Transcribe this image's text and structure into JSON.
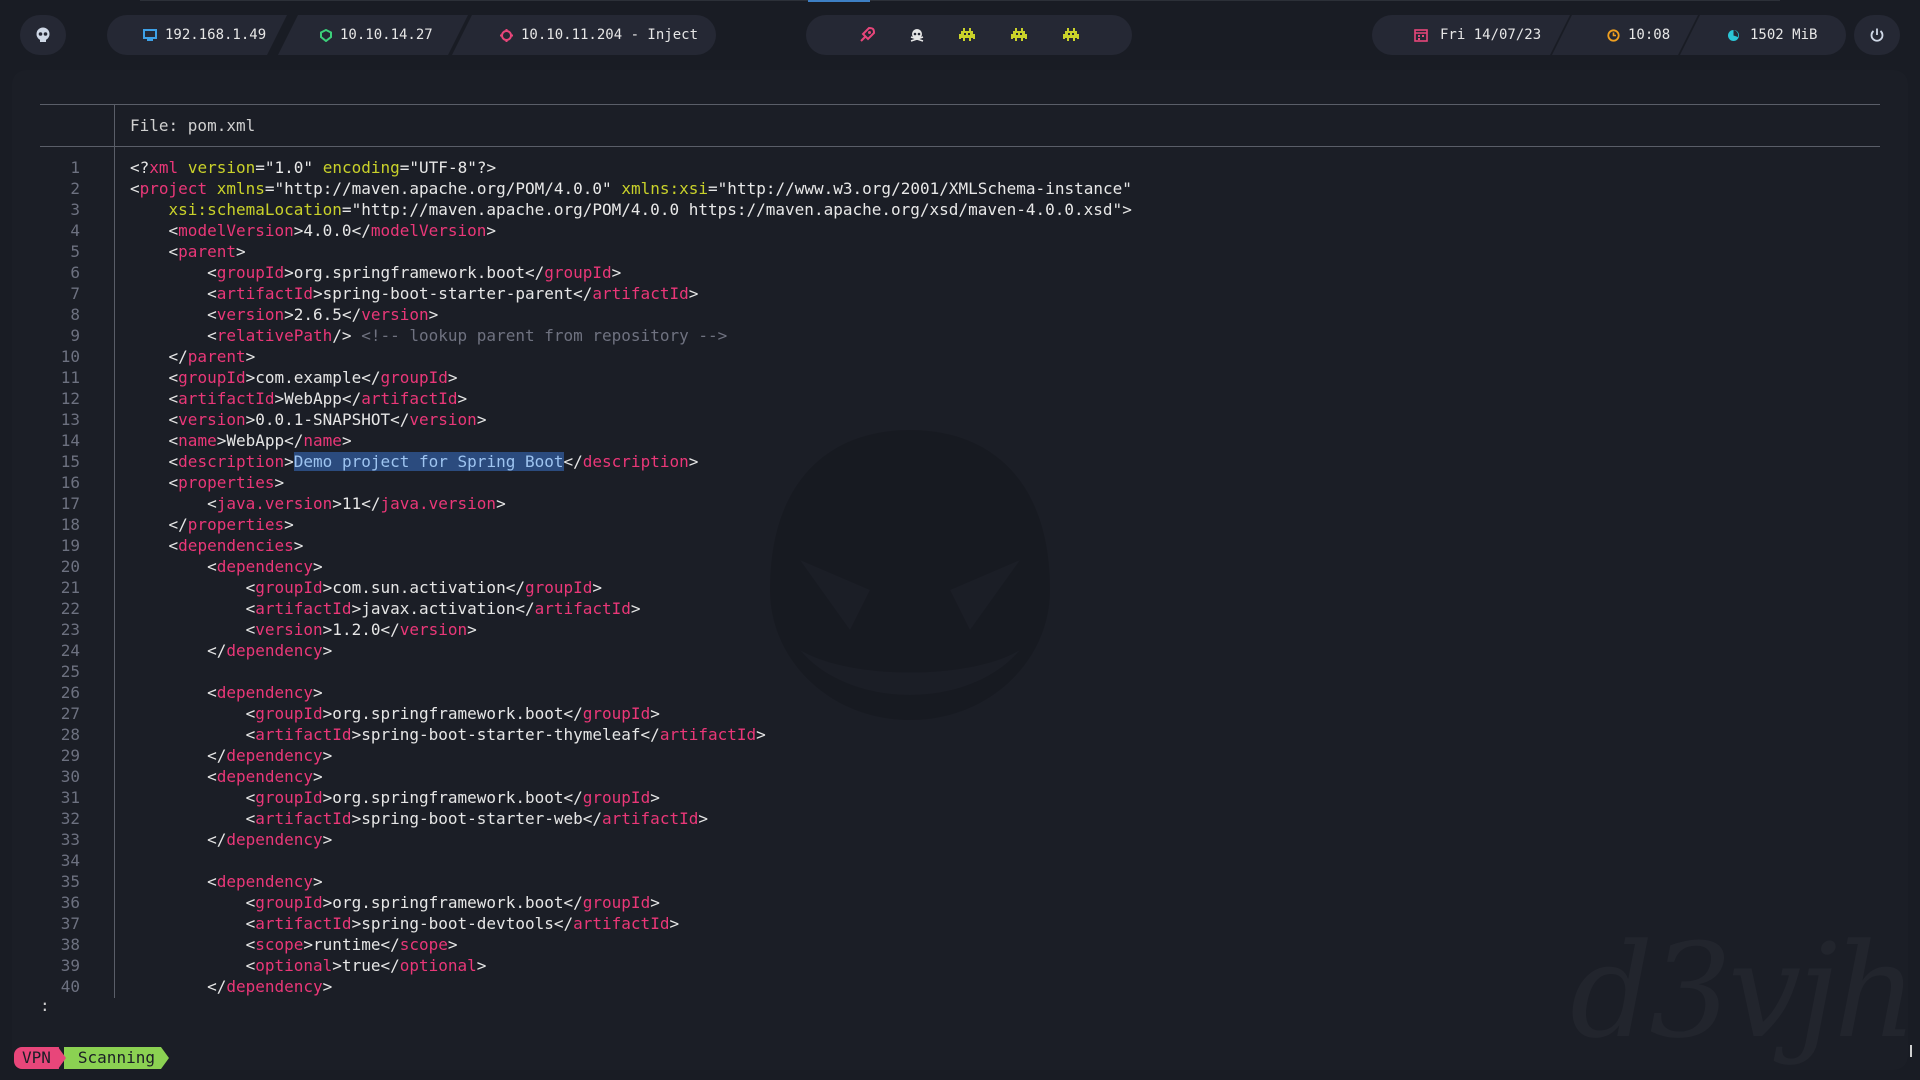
{
  "topbar": {
    "left_ips": [
      {
        "label": "192.168.1.49",
        "icon": "monitor-icon",
        "color": "#3ea0e6"
      },
      {
        "label": "10.10.14.27",
        "icon": "vpn-shield-icon",
        "color": "#3ccf7a"
      },
      {
        "label": "10.10.11.204 - Inject",
        "icon": "target-icon",
        "color": "#e8467a"
      }
    ],
    "center_icons": [
      "rocket-icon",
      "skull-icon",
      "invader-icon",
      "invader-icon",
      "invader-icon"
    ],
    "date": "Fri 14/07/23",
    "time": "10:08",
    "memory": "1502 MiB"
  },
  "editor": {
    "file_header": "File: pom.xml",
    "highlight_text": "Demo project for Spring Boot",
    "lines": [
      "<?xml version=\"1.0\" encoding=\"UTF-8\"?>",
      "<project xmlns=\"http://maven.apache.org/POM/4.0.0\" xmlns:xsi=\"http://www.w3.org/2001/XMLSchema-instance\"",
      "    xsi:schemaLocation=\"http://maven.apache.org/POM/4.0.0 https://maven.apache.org/xsd/maven-4.0.0.xsd\">",
      "    <modelVersion>4.0.0</modelVersion>",
      "    <parent>",
      "        <groupId>org.springframework.boot</groupId>",
      "        <artifactId>spring-boot-starter-parent</artifactId>",
      "        <version>2.6.5</version>",
      "        <relativePath/> <!-- lookup parent from repository -->",
      "    </parent>",
      "    <groupId>com.example</groupId>",
      "    <artifactId>WebApp</artifactId>",
      "    <version>0.0.1-SNAPSHOT</version>",
      "    <name>WebApp</name>",
      "    <description>Demo project for Spring Boot</description>",
      "    <properties>",
      "        <java.version>11</java.version>",
      "    </properties>",
      "    <dependencies>",
      "        <dependency>",
      "            <groupId>com.sun.activation</groupId>",
      "            <artifactId>javax.activation</artifactId>",
      "            <version>1.2.0</version>",
      "        </dependency>",
      "",
      "        <dependency>",
      "            <groupId>org.springframework.boot</groupId>",
      "            <artifactId>spring-boot-starter-thymeleaf</artifactId>",
      "        </dependency>",
      "        <dependency>",
      "            <groupId>org.springframework.boot</groupId>",
      "            <artifactId>spring-boot-starter-web</artifactId>",
      "        </dependency>",
      "",
      "        <dependency>",
      "            <groupId>org.springframework.boot</groupId>",
      "            <artifactId>spring-boot-devtools</artifactId>",
      "            <scope>runtime</scope>",
      "            <optional>true</optional>",
      "        </dependency>"
    ],
    "pager_prompt": ":"
  },
  "statusbar": {
    "vpn_label": "VPN",
    "scan_label": "Scanning"
  },
  "watermark": "d3vjh"
}
